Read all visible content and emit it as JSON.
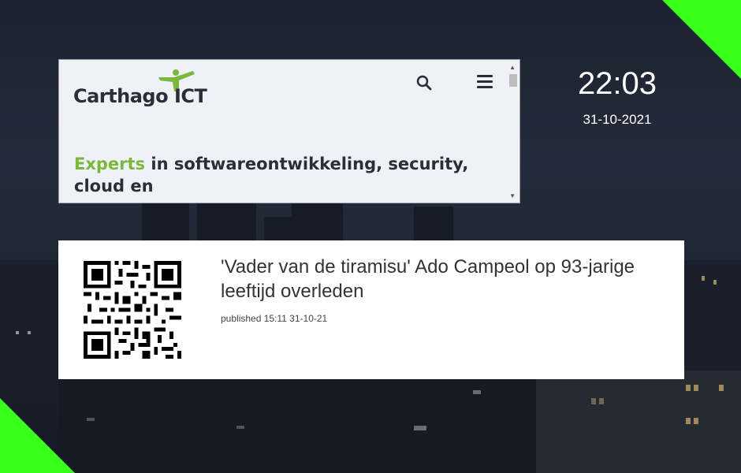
{
  "website": {
    "logo_text": "Carthago",
    "logo_suffix": "ICT",
    "headline_accent": "Experts",
    "headline_rest": " in softwareontwikkeling, security, cloud en"
  },
  "clock": {
    "time": "22:03",
    "date": "31-10-2021"
  },
  "news": {
    "title": "'Vader van de tiramisu' Ado Campeol op 93-jarige leeftijd overleden",
    "meta": "published 15:11 31-10-21"
  },
  "colors": {
    "accent_green": "#39ff1a",
    "brand_green": "#79b83a"
  }
}
